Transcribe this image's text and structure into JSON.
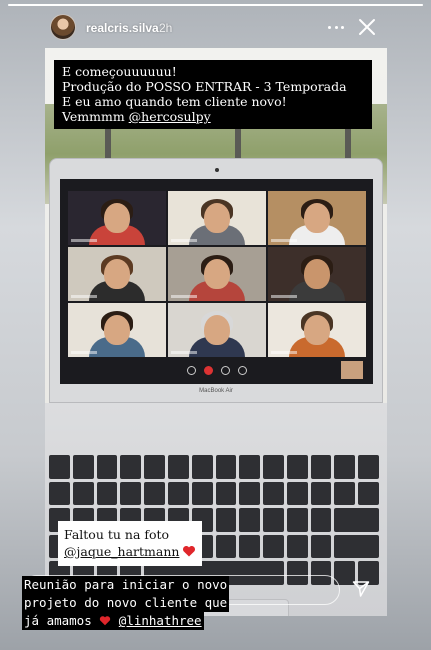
{
  "story": {
    "progress": 1.0
  },
  "header": {
    "username": "realcris.silva",
    "time": "2h"
  },
  "photo": {
    "laptop_brand": "MacBook Air",
    "caption_top": {
      "lines": [
        "E começouuuuuu!",
        "Produção do POSSO ENTRAR - 3 Temporada",
        "E eu amo quando tem cliente novo!"
      ],
      "last_prefix": "Vemmmm ",
      "mention": "@hercosulpy"
    },
    "caption_bottom": {
      "line1": "Faltou tu na foto",
      "mention": "@jaque_hartmann"
    }
  },
  "story_text": {
    "line1": "Reunião para iniciar o novo",
    "line2": "projeto do novo cliente que",
    "line3_prefix": "já amamos",
    "mention": "@linhathree"
  },
  "icons": {
    "close": "close-icon",
    "more": "more-icon",
    "send": "send-icon",
    "heart": "heart-icon"
  },
  "colors": {
    "heart_red": "#e0262b",
    "caption_bg": "#000000",
    "caption_bottom_bg": "#ffffff"
  }
}
